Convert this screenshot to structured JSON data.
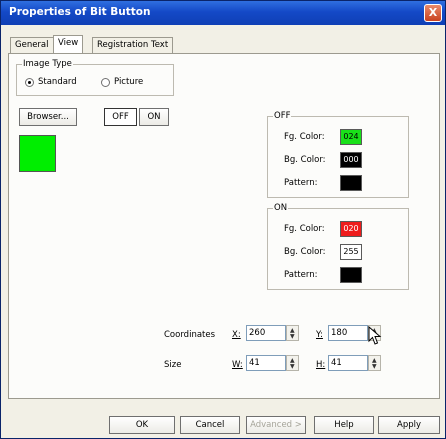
{
  "window": {
    "title": "Properties of Bit Button",
    "close_label": "X"
  },
  "tabs": [
    {
      "label": "General",
      "active": false
    },
    {
      "label": "View",
      "active": true
    },
    {
      "label": "Registration Text",
      "active": false
    }
  ],
  "image_type": {
    "group_label": "Image Type",
    "standard": "Standard",
    "picture": "Picture",
    "selected": "Standard"
  },
  "browser_button": "Browser...",
  "state_toggle": {
    "off": "OFF",
    "on": "ON",
    "active": "OFF"
  },
  "preview_color": "#00ee00",
  "off_group": {
    "label": "OFF",
    "fg_label": "Fg. Color:",
    "fg_value": "024",
    "fg_color": "#19e019",
    "bg_label": "Bg. Color:",
    "bg_value": "000",
    "bg_color": "#000000",
    "pattern_label": "Pattern:",
    "pattern_color": "#000000"
  },
  "on_group": {
    "label": "ON",
    "fg_label": "Fg. Color:",
    "fg_value": "020",
    "fg_color": "#ee1c1c",
    "bg_label": "Bg. Color:",
    "bg_value": "255",
    "bg_color": "#ffffff",
    "pattern_label": "Pattern:",
    "pattern_color": "#000000"
  },
  "coordinates": {
    "label": "Coordinates",
    "x_label": "X:",
    "x_value": "260",
    "y_label": "Y:",
    "y_value": "180"
  },
  "size": {
    "label": "Size",
    "w_label": "W:",
    "w_value": "41",
    "h_label": "H:",
    "h_value": "41"
  },
  "buttons": {
    "ok": "OK",
    "cancel": "Cancel",
    "advanced": "Advanced >",
    "help": "Help",
    "apply": "Apply"
  }
}
